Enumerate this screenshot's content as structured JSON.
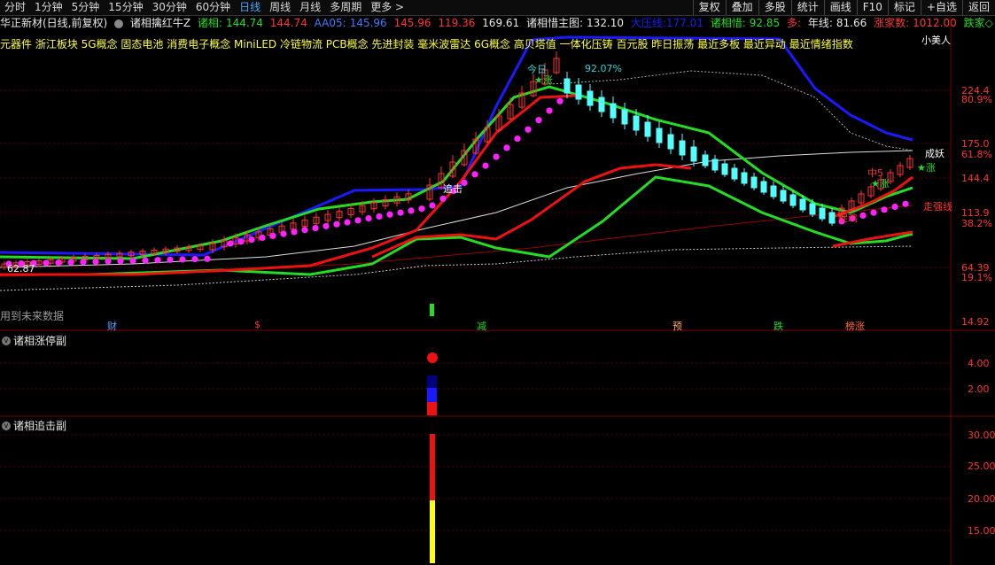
{
  "toolbar": {
    "periods": [
      "分时",
      "1分钟",
      "5分钟",
      "15分钟",
      "30分钟",
      "60分钟",
      "日线",
      "周线",
      "月线",
      "多周期",
      "更多 >"
    ],
    "active": "日线",
    "right_buttons": [
      "复权",
      "叠加",
      "多股",
      "统计",
      "画线",
      "F10",
      "标记",
      "+自选",
      "返回"
    ]
  },
  "header": {
    "title": "华正新材(日线,前复权)",
    "indicator": "诸相擒红牛Z",
    "zx_label": "诸相:",
    "zx_val1": "144.74",
    "zx_val2": "144.74",
    "aa05_label": "AA05:",
    "aa05_val": "145.96",
    "v3": "145.96",
    "v4": "119.36",
    "v5": "169.61",
    "main_label": "诸相惜主图:",
    "main_val": "132.10",
    "yaline": "大压线:177.01",
    "zxx_label": "诸相惜:",
    "zxx_val": "92.85",
    "duo": "多:",
    "nianxian": "年线:",
    "nianxian_val": "81.66",
    "zhangjia": "涨家数:",
    "zhangjia_val": "1012.00",
    "diejia": "跌家◇"
  },
  "concepts": "元器件 浙江板块 5G概念 固态电池 消费电子概念 MiniLED 冷链物流 PCB概念 先进封装 毫米波雷达 6G概念 高贝塔值 一体化压铸 百元股 昨日振荡 最近多板 最近异动 最近情绪指数",
  "right_axis": {
    "main": [
      "224.4",
      "80.9%",
      "175.0",
      "61.8%",
      "144.4",
      "113.9",
      "38.2%",
      "64.39",
      "19.1%",
      "14.92"
    ],
    "sub1": [
      "4.00",
      "2.00"
    ],
    "sub2": [
      "30.00",
      "25.00",
      "20.00",
      "15.00"
    ]
  },
  "panels": {
    "sub1_title": "诸相涨停副",
    "sub2_title": "诸相追击副"
  },
  "annotations": {
    "low_price": "62.87",
    "future": "用到未来数据",
    "pct": "92.07%",
    "jinri": "今日",
    "zhuiji": "追击",
    "zhang1": "★涨",
    "zhang2": "★涨",
    "chengyao": "成妖",
    "zouqiang": "走强线",
    "xiaomeiren": "小美人",
    "zhong": "中5",
    "zhuojiu": "捉鸡"
  },
  "bottom_markers": [
    "财",
    "$",
    "减",
    "预",
    "跌",
    "榜涨"
  ],
  "colors": {
    "up": "#ff3333",
    "down": "#54ffff",
    "green": "#22dd22",
    "red": "#ee1111",
    "blue": "#1a1aff",
    "magenta": "#ff22ff",
    "white": "#dddddd",
    "grid": "#5a0000"
  }
}
